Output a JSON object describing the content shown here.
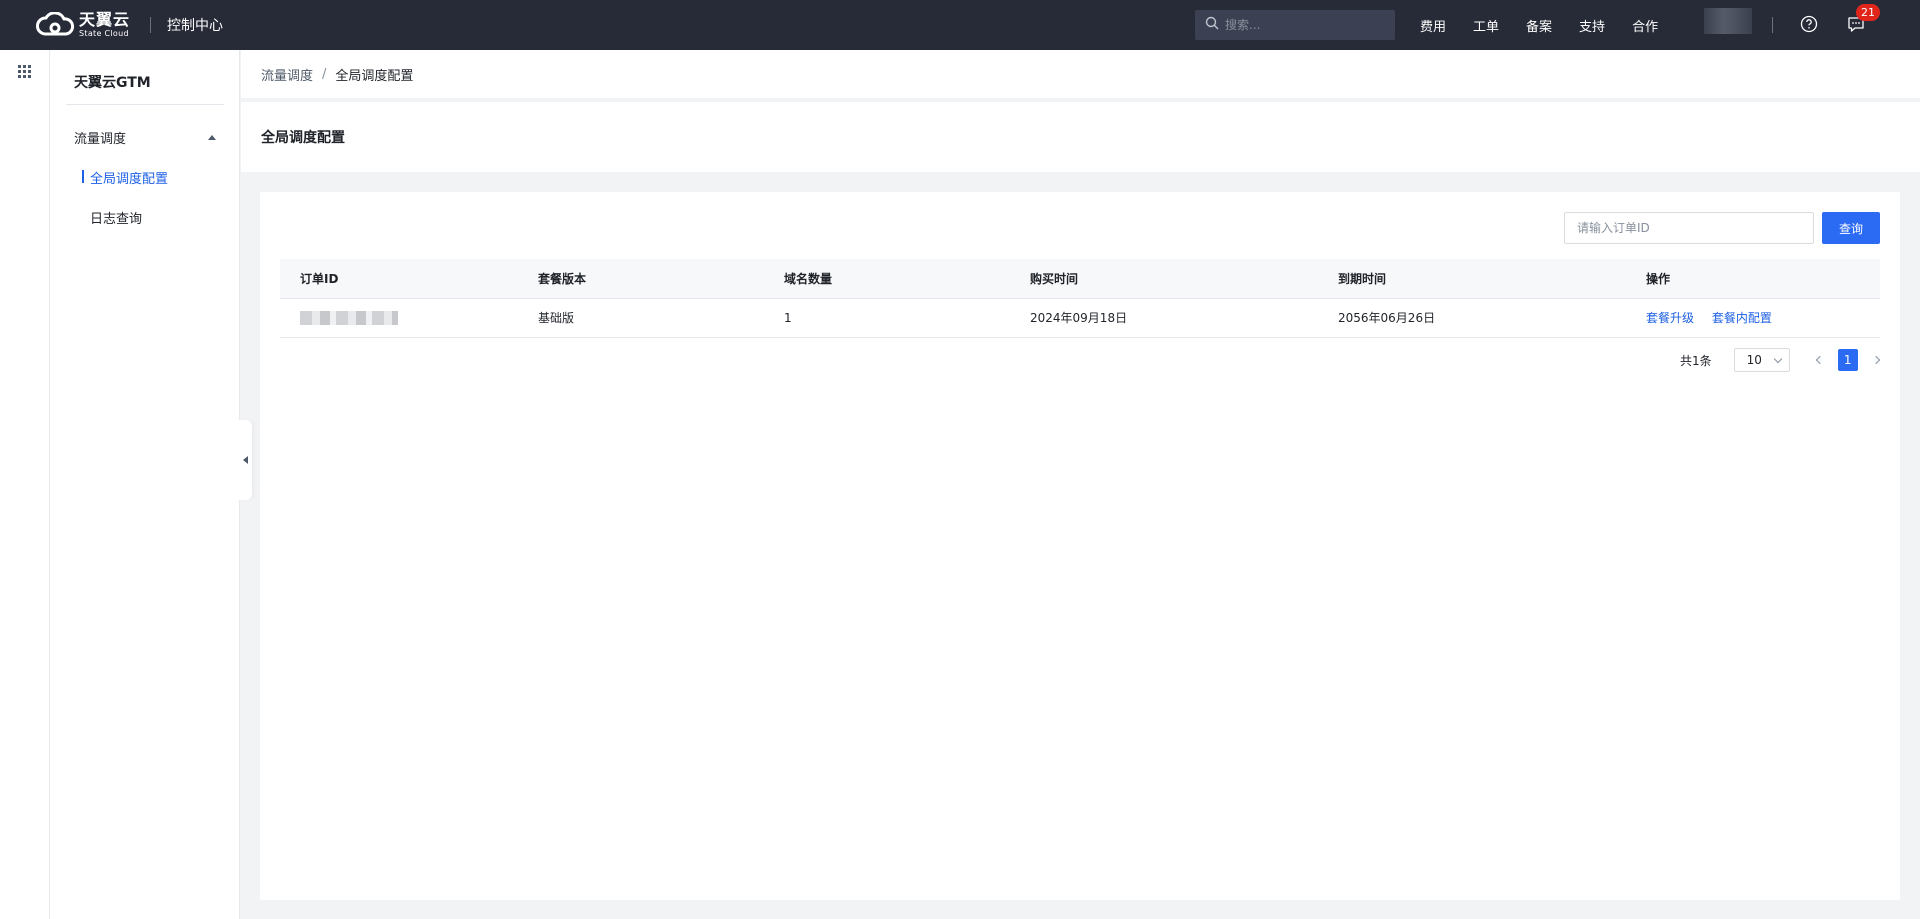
{
  "topbar": {
    "logo_cn": "天翼云",
    "logo_en": "State Cloud",
    "console_title": "控制中心",
    "search_placeholder": "搜索...",
    "nav": [
      "费用",
      "工单",
      "备案",
      "支持",
      "合作"
    ],
    "message_badge": "21"
  },
  "sidebar": {
    "title": "天翼云GTM",
    "group_label": "流量调度",
    "items": [
      {
        "label": "全局调度配置",
        "active": true
      },
      {
        "label": "日志查询",
        "active": false
      }
    ]
  },
  "breadcrumb": {
    "parent": "流量调度",
    "separator": "/",
    "current": "全局调度配置"
  },
  "page_title": "全局调度配置",
  "search": {
    "placeholder": "请输入订单ID",
    "button_label": "查询"
  },
  "table": {
    "columns": [
      "订单ID",
      "套餐版本",
      "域名数量",
      "购买时间",
      "到期时间",
      "操作"
    ],
    "rows": [
      {
        "order_id": "",
        "plan": "基础版",
        "domain_count": "1",
        "purchase_time": "2024年09月18日",
        "expire_time": "2056年06月26日",
        "actions": [
          "套餐升级",
          "套餐内配置"
        ]
      }
    ]
  },
  "pagination": {
    "total": "共1条",
    "page_size": "10",
    "current_page": "1"
  },
  "colors": {
    "topbar_bg": "#272b38",
    "primary": "#2b6bf3",
    "link": "#1f61e6",
    "badge": "#e1251b"
  },
  "icons": {
    "logo": "cloud-logo-icon",
    "search": "search-icon",
    "help": "help-circle-icon",
    "messages": "message-icon",
    "apps": "grid-icon",
    "group_toggle": "caret-up-icon",
    "collapse": "caret-left-icon"
  }
}
